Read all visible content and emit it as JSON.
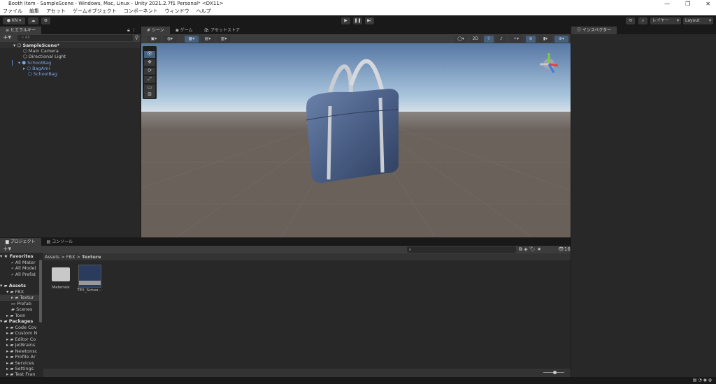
{
  "window": {
    "title": "Booth Item - SampleScene - Windows, Mac, Linux - Unity 2021.2.7f1 Personal* <DX11>"
  },
  "menu": [
    "ファイル",
    "編集",
    "アセット",
    "ゲームオブジェクト",
    "コンポーネント",
    "ウィンドウ",
    "ヘルプ"
  ],
  "toolbar": {
    "account": "KN ▾",
    "layers": "レイヤー",
    "layout": "Layout"
  },
  "hierarchy": {
    "tab": "ヒエラルキー",
    "search_placeholder": "All",
    "items": [
      {
        "label": "SampleScene*"
      },
      {
        "label": "Main Camera"
      },
      {
        "label": "Directional Light"
      },
      {
        "label": "SchoolBag"
      },
      {
        "label": "BagAmr"
      },
      {
        "label": "SchoolBag"
      }
    ]
  },
  "scene_tabs": [
    "シーン",
    "ゲーム",
    "アセットストア"
  ],
  "scene_toolbar": {
    "mode_2d": "2D"
  },
  "inspector": {
    "tab": "インスペクター"
  },
  "project": {
    "tabs": [
      "プロジェクト",
      "コンソール"
    ],
    "breadcrumb": [
      "Assets",
      "FBX",
      "Texture"
    ],
    "count": "16",
    "tree": [
      "Favorites",
      "All Mater",
      "All Model",
      "All Prefat",
      "Assets",
      "FBX",
      "Textur",
      "Prefab",
      "Scenes",
      "Toon",
      "Packages",
      "Code Cov",
      "Custom N",
      "Editor Co",
      "JetBrains",
      "Newtonsc",
      "Profile Ar",
      "Services",
      "Settings",
      "Test Fran"
    ],
    "assets": [
      "Materials",
      "TEX_Schoo···"
    ]
  },
  "colors": {
    "accent": "#7ba4e8",
    "bag": "#3f5478"
  }
}
